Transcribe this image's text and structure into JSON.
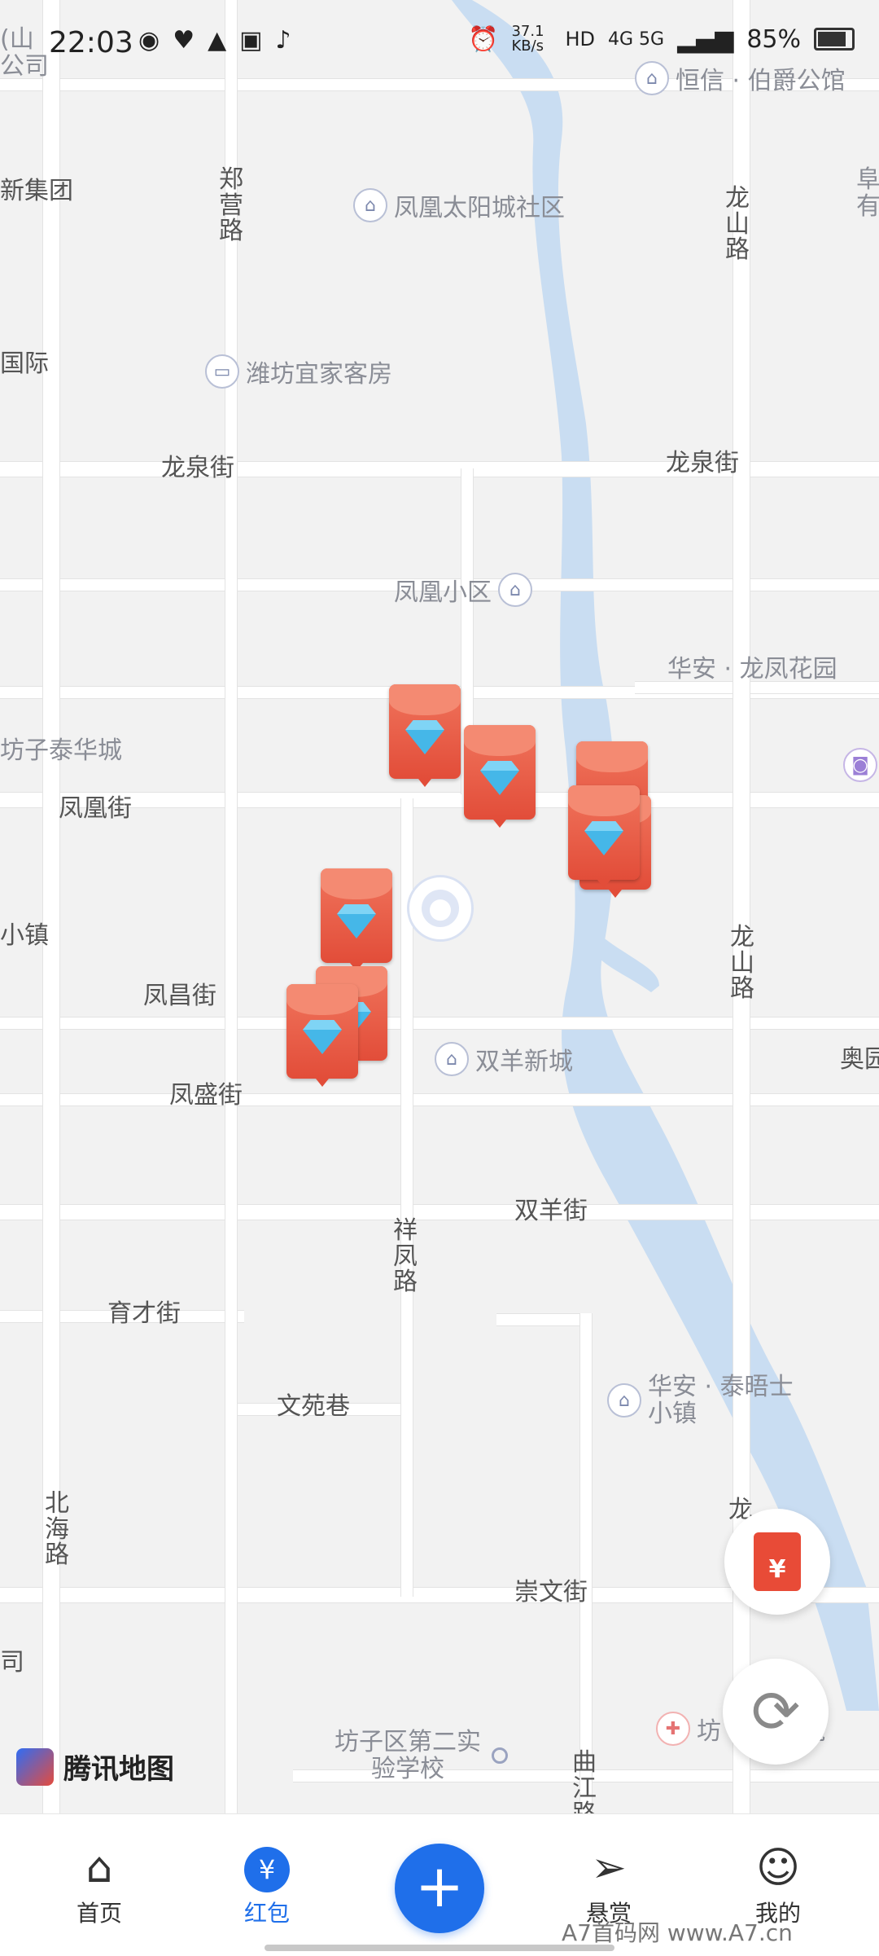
{
  "status_bar": {
    "time": "22:03",
    "network_speed": "37.1 KB/s",
    "network": "4G 5G",
    "battery": "85%"
  },
  "map": {
    "roads": {
      "north_top_left": "郑营路",
      "longquan_left": "龙泉街",
      "longquan_right": "龙泉街",
      "fenghuang": "凤凰街",
      "fengchang": "凤昌街",
      "fengsheng": "凤盛街",
      "shuangyang": "双羊街",
      "xiangfeng": "祥凤路",
      "yucai": "育才街",
      "wenyuan": "文苑巷",
      "beihai": "北海路",
      "chongwen": "崇文街",
      "qujiang": "曲江路",
      "longshan_top": "龙山路",
      "longshan_mid": "龙山路",
      "long_short": "龙"
    },
    "pois": {
      "hengxin": "恒信 · 伯爵公馆",
      "sun_city": "凤凰太阳城社区",
      "weifang_hotel": "潍坊宜家客房",
      "fenghuang_xiaoqu": "凤凰小区",
      "huaan_longfeng": "华安 · 龙凤花园",
      "fangzi_taihua": "坊子泰华城",
      "shuangyang_xincheng": "双羊新城",
      "huaan_taiwushi": "华安 · 泰晤士小镇",
      "school": "坊子区第二实验学校",
      "hospital_partial": "坊    民医院"
    },
    "partial_edges": {
      "left_top": "(山\n公司",
      "left_jituan": "新集团",
      "left_guoji": "国际",
      "left_xiaozhen": "小镇",
      "left_si": "司",
      "right_top": "阜\n有",
      "right_ao": "奥园"
    },
    "provider": "腾讯地图"
  },
  "bottom_nav": {
    "items": [
      {
        "label": "首页",
        "icon": "home-icon"
      },
      {
        "label": "红包",
        "icon": "red-packet-icon"
      },
      {
        "label": "",
        "icon": "plus-icon"
      },
      {
        "label": "悬赏",
        "icon": "paper-plane-icon"
      },
      {
        "label": "我的",
        "icon": "user-icon"
      }
    ]
  },
  "watermark": "A7首码网    www.A7.cn",
  "colors": {
    "accent": "#1f6fea",
    "red_packet": "#e24d39",
    "river": "#c9ddf2"
  }
}
